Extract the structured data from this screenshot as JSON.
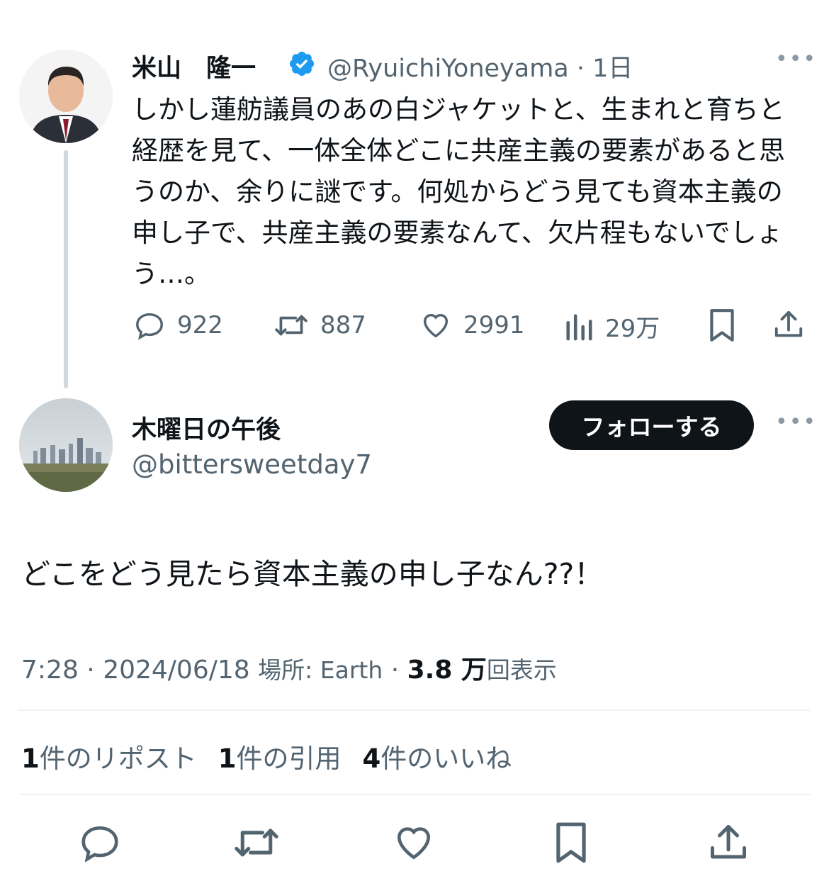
{
  "original_tweet": {
    "author_name": "米山　隆一",
    "handle": "@RyuichiYoneyama",
    "time": "1日",
    "text": "しかし蓮舫議員のあの白ジャケットと、生まれと育ちと経歴を見て、一体全体どこに共産主義の要素があると思うのか、余りに謎です。何処からどう見ても資本主義の申し子で、共産主義の要素なんて、欠片程もないでしょう…。",
    "verified": true,
    "replies": "922",
    "retweets": "887",
    "likes": "2991",
    "views": "29万"
  },
  "reply_tweet": {
    "author_name": "木曜日の午後",
    "handle": "@bittersweetday7",
    "follow_label": "フォローする",
    "text": "どこをどう見たら資本主義の申し子なん??！",
    "time": "7:28",
    "date": "2024/06/18",
    "location": "場所: Earth",
    "view_count": "3.8 万",
    "view_label": "回表示",
    "reposts_count": "1",
    "reposts_label": "件のリポスト",
    "quotes_count": "1",
    "quotes_label": "件の引用",
    "likes_count": "4",
    "likes_label": "件のいいね"
  },
  "colors": {
    "text_primary": "#0f1419",
    "text_secondary": "#536471",
    "verified_blue": "#1d9bf0",
    "follow_button_bg": "#0f1419",
    "divider": "#eff3f4"
  },
  "icons": [
    "reply-icon",
    "retweet-icon",
    "like-icon",
    "views-icon",
    "bookmark-icon",
    "share-icon",
    "more-icon",
    "verified-badge-icon"
  ]
}
